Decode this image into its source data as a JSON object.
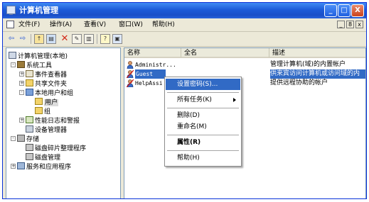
{
  "window": {
    "title": "计算机管理",
    "controls": {
      "minimize": "_",
      "maximize": "□",
      "close": "X"
    }
  },
  "menubar": {
    "items": [
      "文件(F)",
      "操作(A)",
      "查看(V)",
      "窗口(W)",
      "帮助(H)"
    ],
    "mdi_controls": [
      "_",
      "8",
      "x"
    ]
  },
  "toolbar": {
    "icons": [
      "back-arrow-icon",
      "forward-arrow-icon",
      "up-folder-icon",
      "show-tree-icon",
      "delete-icon",
      "properties-icon",
      "export-icon",
      "help-icon",
      "console-icon"
    ]
  },
  "tree": {
    "items": [
      {
        "label": "计算机管理(本地)",
        "icon": "computer-management-icon"
      },
      {
        "label": "系统工具",
        "icon": "system-tools-icon",
        "expander": "-"
      },
      {
        "label": "事件查看器",
        "icon": "event-viewer-icon",
        "expander": "+"
      },
      {
        "label": "共享文件夹",
        "icon": "shared-folders-icon",
        "expander": "+"
      },
      {
        "label": "本地用户和组",
        "icon": "local-users-icon",
        "expander": "-"
      },
      {
        "label": "用户",
        "icon": "folder-icon",
        "selected": true
      },
      {
        "label": "组",
        "icon": "folder-icon"
      },
      {
        "label": "性能日志和警报",
        "icon": "performance-icon",
        "expander": "+"
      },
      {
        "label": "设备管理器",
        "icon": "device-manager-icon"
      },
      {
        "label": "存储",
        "icon": "storage-icon",
        "expander": "-"
      },
      {
        "label": "磁盘碎片整理程序",
        "icon": "defrag-icon"
      },
      {
        "label": "磁盘管理",
        "icon": "disk-management-icon"
      },
      {
        "label": "服务和应用程序",
        "icon": "services-icon",
        "expander": "+"
      }
    ]
  },
  "list": {
    "columns": [
      "名称",
      "全名",
      "描述"
    ],
    "rows": [
      {
        "name": "Administr...",
        "fullname": "",
        "description": "管理计算机(域)的内置帐户"
      },
      {
        "name": "Guest",
        "fullname": "",
        "description": "供来宾访问计算机或访问域的内",
        "selected": true
      },
      {
        "name": "HelpAssi",
        "fullname": "",
        "description": "提供远程协助的帐户"
      }
    ]
  },
  "context_menu": {
    "items": [
      {
        "label": "设置密码(S)...",
        "highlighted": true
      },
      {
        "label": "所有任务(K)",
        "submenu": true
      },
      {
        "label": "删除(D)"
      },
      {
        "label": "重命名(M)"
      },
      {
        "label": "属性(R)",
        "bold": true
      },
      {
        "label": "帮助(H)"
      }
    ]
  },
  "colors": {
    "title_gradient": "#1c5ad8",
    "selection": "#316ac5",
    "window_face": "#ece9d8"
  }
}
